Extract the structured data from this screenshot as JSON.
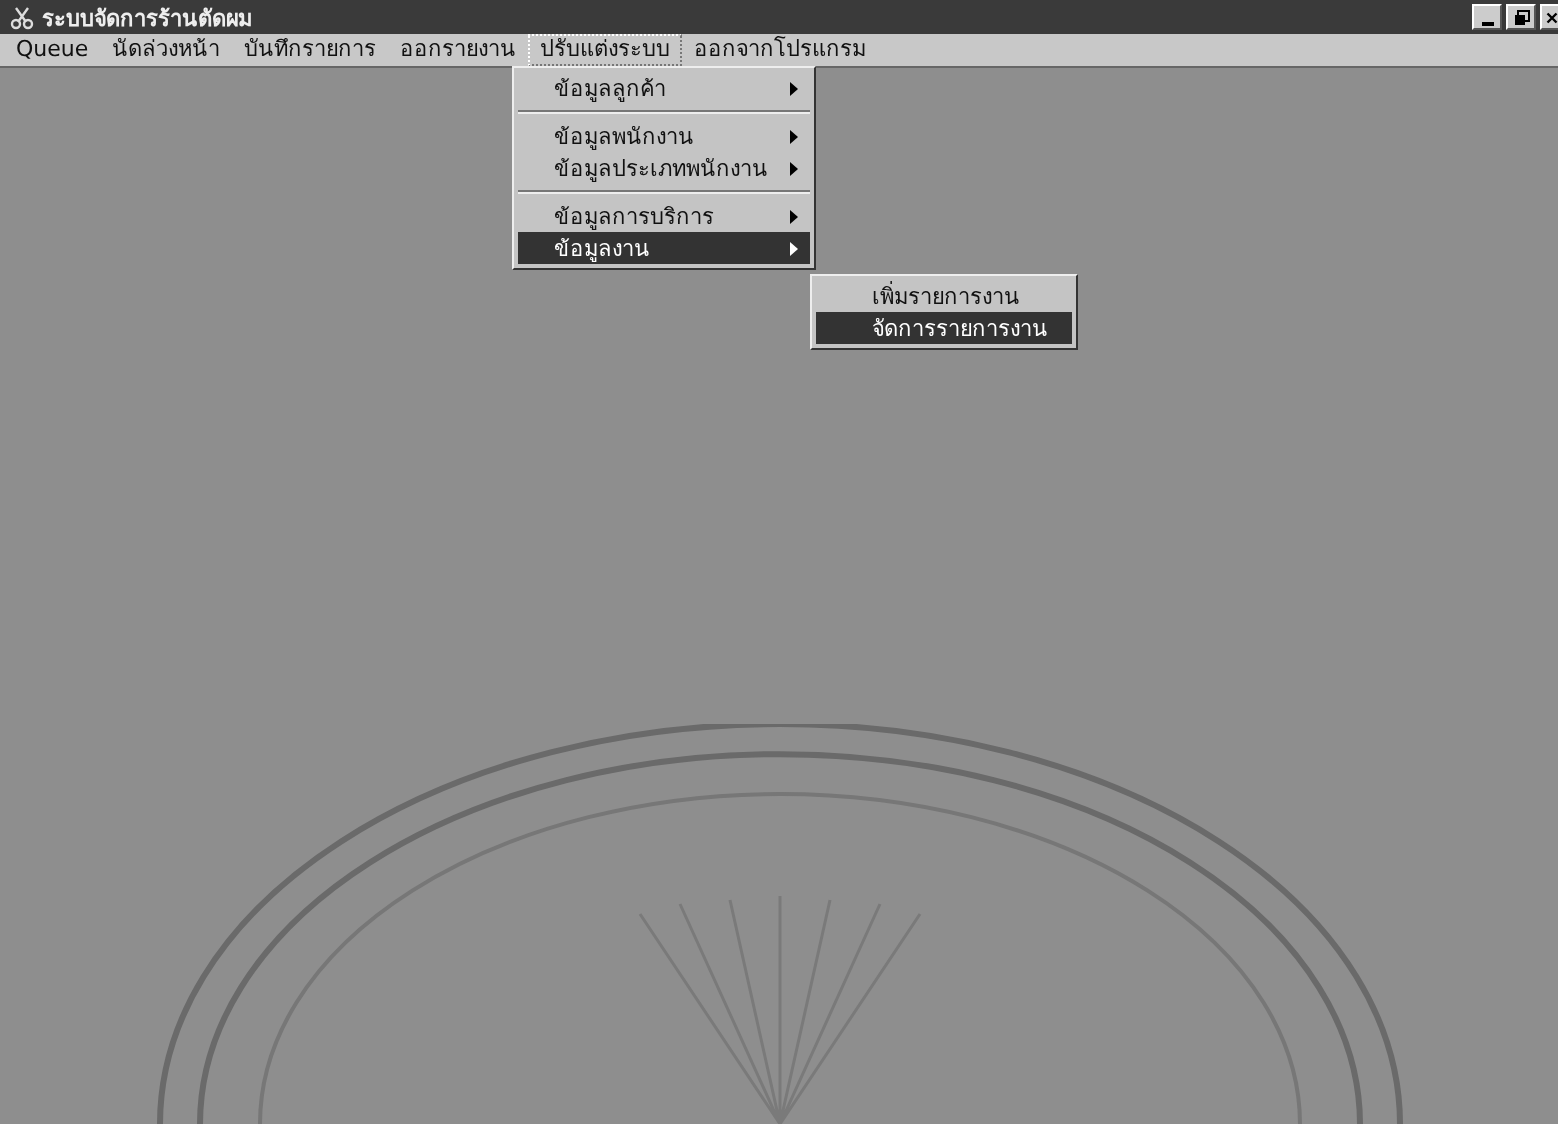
{
  "window": {
    "title": "ระบบจัดการร้านตัดผม"
  },
  "menu_bar": [
    {
      "label": "Queue",
      "selected": false
    },
    {
      "label": "นัดล่วงหน้า",
      "selected": false
    },
    {
      "label": "บันทึกรายการ",
      "selected": false
    },
    {
      "label": "ออกรายงาน",
      "selected": false
    },
    {
      "label": "ปรับแต่งระบบ",
      "selected": true
    },
    {
      "label": "ออกจากโปรแกรม",
      "selected": false
    }
  ],
  "dropdown": [
    {
      "kind": "item",
      "label": "ข้อมูลลูกค้า",
      "has_submenu": true,
      "selected": false
    },
    {
      "kind": "separator"
    },
    {
      "kind": "item",
      "label": "ข้อมูลพนักงาน",
      "has_submenu": true,
      "selected": false
    },
    {
      "kind": "item",
      "label": "ข้อมูลประเภทพนักงาน",
      "has_submenu": true,
      "selected": false
    },
    {
      "kind": "separator"
    },
    {
      "kind": "item",
      "label": "ข้อมูลการบริการ",
      "has_submenu": true,
      "selected": false
    },
    {
      "kind": "item",
      "label": "ข้อมูลงาน",
      "has_submenu": true,
      "selected": true
    }
  ],
  "submenu": [
    {
      "kind": "item",
      "label": "เพิ่มรายการงาน",
      "has_submenu": false,
      "selected": false
    },
    {
      "kind": "item",
      "label": "จัดการรายการงาน",
      "has_submenu": false,
      "selected": true
    }
  ]
}
